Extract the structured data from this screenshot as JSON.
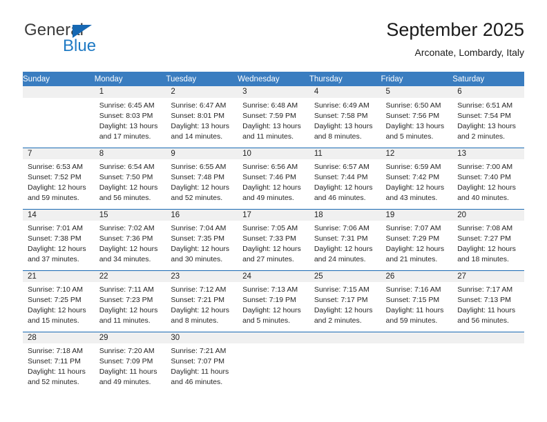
{
  "brand": {
    "name_top": "General",
    "name_bottom": "Blue",
    "triangle_icon": "triangle-icon",
    "accent_blue": "#1f7ac4",
    "dark_text": "#3b3b3b"
  },
  "header": {
    "title": "September 2025",
    "subtitle": "Arconate, Lombardy, Italy"
  },
  "theme": {
    "header_blue": "#3a7dc0",
    "row_divider_blue": "#1668b3",
    "date_band_gray": "#f0f0f0"
  },
  "weekday_headers": [
    "Sunday",
    "Monday",
    "Tuesday",
    "Wednesday",
    "Thursday",
    "Friday",
    "Saturday"
  ],
  "weeks": [
    {
      "days": [
        {
          "date": "",
          "sunrise": "",
          "sunset": "",
          "daylight_1": "",
          "daylight_2": "",
          "empty": true
        },
        {
          "date": "1",
          "sunrise": "Sunrise: 6:45 AM",
          "sunset": "Sunset: 8:03 PM",
          "daylight_1": "Daylight: 13 hours",
          "daylight_2": "and 17 minutes."
        },
        {
          "date": "2",
          "sunrise": "Sunrise: 6:47 AM",
          "sunset": "Sunset: 8:01 PM",
          "daylight_1": "Daylight: 13 hours",
          "daylight_2": "and 14 minutes."
        },
        {
          "date": "3",
          "sunrise": "Sunrise: 6:48 AM",
          "sunset": "Sunset: 7:59 PM",
          "daylight_1": "Daylight: 13 hours",
          "daylight_2": "and 11 minutes."
        },
        {
          "date": "4",
          "sunrise": "Sunrise: 6:49 AM",
          "sunset": "Sunset: 7:58 PM",
          "daylight_1": "Daylight: 13 hours",
          "daylight_2": "and 8 minutes."
        },
        {
          "date": "5",
          "sunrise": "Sunrise: 6:50 AM",
          "sunset": "Sunset: 7:56 PM",
          "daylight_1": "Daylight: 13 hours",
          "daylight_2": "and 5 minutes."
        },
        {
          "date": "6",
          "sunrise": "Sunrise: 6:51 AM",
          "sunset": "Sunset: 7:54 PM",
          "daylight_1": "Daylight: 13 hours",
          "daylight_2": "and 2 minutes."
        }
      ]
    },
    {
      "days": [
        {
          "date": "7",
          "sunrise": "Sunrise: 6:53 AM",
          "sunset": "Sunset: 7:52 PM",
          "daylight_1": "Daylight: 12 hours",
          "daylight_2": "and 59 minutes."
        },
        {
          "date": "8",
          "sunrise": "Sunrise: 6:54 AM",
          "sunset": "Sunset: 7:50 PM",
          "daylight_1": "Daylight: 12 hours",
          "daylight_2": "and 56 minutes."
        },
        {
          "date": "9",
          "sunrise": "Sunrise: 6:55 AM",
          "sunset": "Sunset: 7:48 PM",
          "daylight_1": "Daylight: 12 hours",
          "daylight_2": "and 52 minutes."
        },
        {
          "date": "10",
          "sunrise": "Sunrise: 6:56 AM",
          "sunset": "Sunset: 7:46 PM",
          "daylight_1": "Daylight: 12 hours",
          "daylight_2": "and 49 minutes."
        },
        {
          "date": "11",
          "sunrise": "Sunrise: 6:57 AM",
          "sunset": "Sunset: 7:44 PM",
          "daylight_1": "Daylight: 12 hours",
          "daylight_2": "and 46 minutes."
        },
        {
          "date": "12",
          "sunrise": "Sunrise: 6:59 AM",
          "sunset": "Sunset: 7:42 PM",
          "daylight_1": "Daylight: 12 hours",
          "daylight_2": "and 43 minutes."
        },
        {
          "date": "13",
          "sunrise": "Sunrise: 7:00 AM",
          "sunset": "Sunset: 7:40 PM",
          "daylight_1": "Daylight: 12 hours",
          "daylight_2": "and 40 minutes."
        }
      ]
    },
    {
      "days": [
        {
          "date": "14",
          "sunrise": "Sunrise: 7:01 AM",
          "sunset": "Sunset: 7:38 PM",
          "daylight_1": "Daylight: 12 hours",
          "daylight_2": "and 37 minutes."
        },
        {
          "date": "15",
          "sunrise": "Sunrise: 7:02 AM",
          "sunset": "Sunset: 7:36 PM",
          "daylight_1": "Daylight: 12 hours",
          "daylight_2": "and 34 minutes."
        },
        {
          "date": "16",
          "sunrise": "Sunrise: 7:04 AM",
          "sunset": "Sunset: 7:35 PM",
          "daylight_1": "Daylight: 12 hours",
          "daylight_2": "and 30 minutes."
        },
        {
          "date": "17",
          "sunrise": "Sunrise: 7:05 AM",
          "sunset": "Sunset: 7:33 PM",
          "daylight_1": "Daylight: 12 hours",
          "daylight_2": "and 27 minutes."
        },
        {
          "date": "18",
          "sunrise": "Sunrise: 7:06 AM",
          "sunset": "Sunset: 7:31 PM",
          "daylight_1": "Daylight: 12 hours",
          "daylight_2": "and 24 minutes."
        },
        {
          "date": "19",
          "sunrise": "Sunrise: 7:07 AM",
          "sunset": "Sunset: 7:29 PM",
          "daylight_1": "Daylight: 12 hours",
          "daylight_2": "and 21 minutes."
        },
        {
          "date": "20",
          "sunrise": "Sunrise: 7:08 AM",
          "sunset": "Sunset: 7:27 PM",
          "daylight_1": "Daylight: 12 hours",
          "daylight_2": "and 18 minutes."
        }
      ]
    },
    {
      "days": [
        {
          "date": "21",
          "sunrise": "Sunrise: 7:10 AM",
          "sunset": "Sunset: 7:25 PM",
          "daylight_1": "Daylight: 12 hours",
          "daylight_2": "and 15 minutes."
        },
        {
          "date": "22",
          "sunrise": "Sunrise: 7:11 AM",
          "sunset": "Sunset: 7:23 PM",
          "daylight_1": "Daylight: 12 hours",
          "daylight_2": "and 11 minutes."
        },
        {
          "date": "23",
          "sunrise": "Sunrise: 7:12 AM",
          "sunset": "Sunset: 7:21 PM",
          "daylight_1": "Daylight: 12 hours",
          "daylight_2": "and 8 minutes."
        },
        {
          "date": "24",
          "sunrise": "Sunrise: 7:13 AM",
          "sunset": "Sunset: 7:19 PM",
          "daylight_1": "Daylight: 12 hours",
          "daylight_2": "and 5 minutes."
        },
        {
          "date": "25",
          "sunrise": "Sunrise: 7:15 AM",
          "sunset": "Sunset: 7:17 PM",
          "daylight_1": "Daylight: 12 hours",
          "daylight_2": "and 2 minutes."
        },
        {
          "date": "26",
          "sunrise": "Sunrise: 7:16 AM",
          "sunset": "Sunset: 7:15 PM",
          "daylight_1": "Daylight: 11 hours",
          "daylight_2": "and 59 minutes."
        },
        {
          "date": "27",
          "sunrise": "Sunrise: 7:17 AM",
          "sunset": "Sunset: 7:13 PM",
          "daylight_1": "Daylight: 11 hours",
          "daylight_2": "and 56 minutes."
        }
      ]
    },
    {
      "days": [
        {
          "date": "28",
          "sunrise": "Sunrise: 7:18 AM",
          "sunset": "Sunset: 7:11 PM",
          "daylight_1": "Daylight: 11 hours",
          "daylight_2": "and 52 minutes."
        },
        {
          "date": "29",
          "sunrise": "Sunrise: 7:20 AM",
          "sunset": "Sunset: 7:09 PM",
          "daylight_1": "Daylight: 11 hours",
          "daylight_2": "and 49 minutes."
        },
        {
          "date": "30",
          "sunrise": "Sunrise: 7:21 AM",
          "sunset": "Sunset: 7:07 PM",
          "daylight_1": "Daylight: 11 hours",
          "daylight_2": "and 46 minutes."
        },
        {
          "date": "",
          "sunrise": "",
          "sunset": "",
          "daylight_1": "",
          "daylight_2": "",
          "empty": true
        },
        {
          "date": "",
          "sunrise": "",
          "sunset": "",
          "daylight_1": "",
          "daylight_2": "",
          "empty": true
        },
        {
          "date": "",
          "sunrise": "",
          "sunset": "",
          "daylight_1": "",
          "daylight_2": "",
          "empty": true
        },
        {
          "date": "",
          "sunrise": "",
          "sunset": "",
          "daylight_1": "",
          "daylight_2": "",
          "empty": true
        }
      ]
    }
  ]
}
